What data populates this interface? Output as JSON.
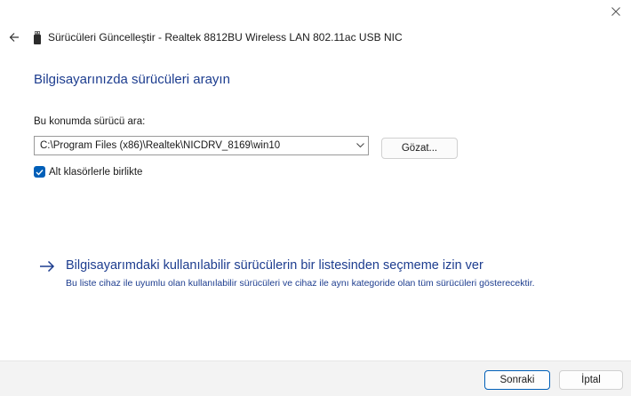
{
  "window": {
    "title": "Sürücüleri Güncelleştir - Realtek 8812BU Wireless LAN 802.11ac USB NIC",
    "title_icon": "usb-device-icon",
    "close_icon": "close-icon",
    "back_icon": "back-arrow-icon"
  },
  "main": {
    "heading": "Bilgisayarınızda sürücüleri arayın",
    "path_label": "Bu konumda sürücü ara:",
    "path_value": "C:\\Program Files (x86)\\Realtek\\NICDRV_8169\\win10",
    "browse_label": "Gözat...",
    "include_subfolders_label": "Alt klasörlerle birlikte",
    "include_subfolders_checked": true
  },
  "pick_option": {
    "title": "Bilgisayarımdaki kullanılabilir sürücülerin bir listesinden seçmeme izin ver",
    "description": "Bu liste cihaz ile uyumlu olan kullanılabilir sürücüleri ve cihaz ile aynı kategoride olan tüm sürücüleri gösterecektir.",
    "icon": "right-arrow-icon"
  },
  "footer": {
    "next_label": "Sonraki",
    "cancel_label": "İptal"
  },
  "colors": {
    "accent": "#005fb8",
    "link": "#1d3d8f",
    "footer_bg": "#f3f3f3"
  }
}
